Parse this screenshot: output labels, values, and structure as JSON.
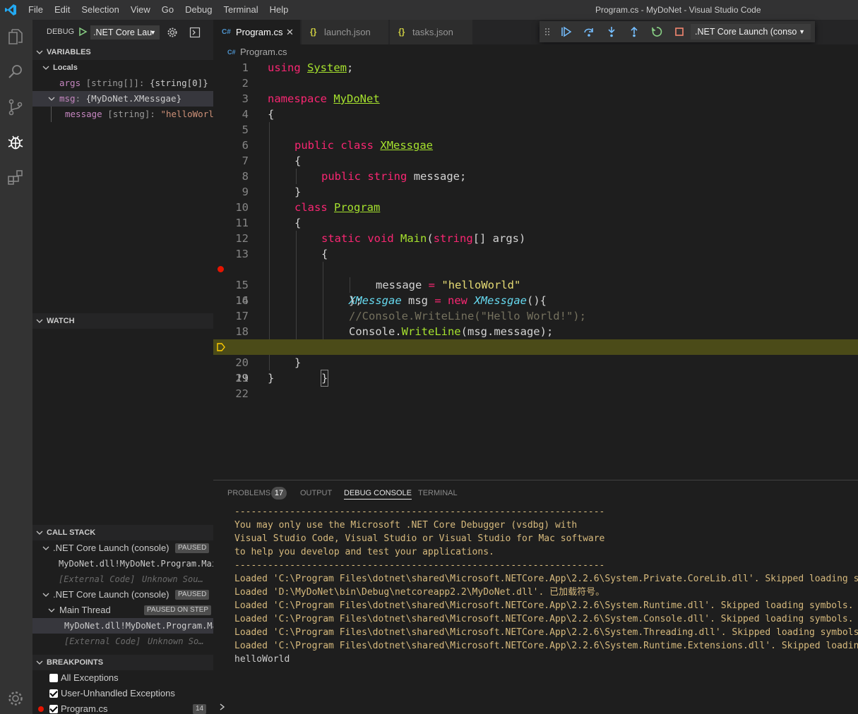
{
  "titlebar": {
    "menu": [
      "File",
      "Edit",
      "Selection",
      "View",
      "Go",
      "Debug",
      "Terminal",
      "Help"
    ],
    "title": "Program.cs - MyDoNet - Visual Studio Code"
  },
  "sidebar": {
    "debug_label": "DEBUG",
    "config": ".NET Core Lau",
    "variables": {
      "header": "VARIABLES",
      "locals": "Locals",
      "items": [
        {
          "name": "args",
          "type": " [string[]]: ",
          "value": "{string[0]}"
        },
        {
          "name": "msg",
          "type": ": ",
          "value": "{MyDoNet.XMessgae}"
        },
        {
          "name": "message",
          "type": " [string]: ",
          "value": "\"helloWorl…"
        }
      ]
    },
    "watch": {
      "header": "WATCH"
    },
    "callstack": {
      "header": "CALL STACK",
      "sessions": [
        {
          "name": ".NET Core Launch (console)",
          "badge": "PAUSED"
        },
        {
          "name": ".NET Core Launch (console)",
          "badge": "PAUSED"
        }
      ],
      "frame1": "MyDoNet.dll!MyDoNet.Program.Mai",
      "external1": "[External Code]",
      "unknown1": "Unknown Sou…",
      "thread": "Main Thread",
      "thread_badge": "PAUSED ON STEP",
      "frame2": "MyDoNet.dll!MyDoNet.Program.Ma",
      "external2": "[External Code]",
      "unknown2": "Unknown So…"
    },
    "breakpoints": {
      "header": "BREAKPOINTS",
      "items": [
        {
          "label": "All Exceptions",
          "checked": false
        },
        {
          "label": "User-Unhandled Exceptions",
          "checked": true
        },
        {
          "label": "Program.cs",
          "checked": true,
          "line": "14"
        }
      ]
    }
  },
  "tabs": [
    {
      "label": "Program.cs",
      "icon": "C#",
      "active": true
    },
    {
      "label": "launch.json",
      "icon": "{}",
      "active": false
    },
    {
      "label": "tasks.json",
      "icon": "{}",
      "active": false
    }
  ],
  "debug_toolbar": {
    "launch": ".NET Core Launch (conso"
  },
  "breadcrumb": {
    "file": "Program.cs"
  },
  "editor": {
    "line_numbers": [
      "1",
      "2",
      "3",
      "4",
      "5",
      "6",
      "7",
      "8",
      "9",
      "10",
      "11",
      "12",
      "13",
      "14",
      "15",
      "16",
      "17",
      "18",
      "19",
      "20",
      "21",
      "22"
    ],
    "t": {
      "using": "using",
      "System": "System",
      "semi": ";",
      "namespace": "namespace",
      "MyDoNet": "MyDoNet",
      "lbrace": "{",
      "rbrace": "}",
      "public": "public",
      "class": "class",
      "XMessgae": "XMessgae",
      "string": "string",
      "message": "message",
      "Program": "Program",
      "static": "static",
      "void": "void",
      "Main": "Main",
      "stringarr": "string",
      "args": "[] args)",
      "msg": " msg ",
      "eq": "=",
      "new": "new",
      "ctor": "(){",
      "helloWorld": "\"helloWorld\"",
      "closeinit": "};",
      "comment": "//Console.WriteLine(\"Hello World!\");",
      "Console": "Console.",
      "WriteLine": "WriteLine",
      "wlargs": "(msg.message);"
    }
  },
  "panel": {
    "tabs": [
      "PROBLEMS",
      "OUTPUT",
      "DEBUG CONSOLE",
      "TERMINAL"
    ],
    "problems_count": "17",
    "lines": [
      {
        "text": "-------------------------------------------------------------------",
        "kind": "warn"
      },
      {
        "text": "You may only use the Microsoft .NET Core Debugger (vsdbg) with",
        "kind": "warn"
      },
      {
        "text": "Visual Studio Code, Visual Studio or Visual Studio for Mac software",
        "kind": "warn"
      },
      {
        "text": "to help you develop and test your applications.",
        "kind": "warn"
      },
      {
        "text": "-------------------------------------------------------------------",
        "kind": "warn"
      },
      {
        "text": "Loaded 'C:\\Program Files\\dotnet\\shared\\Microsoft.NETCore.App\\2.2.6\\System.Private.CoreLib.dll'. Skipped loading sym",
        "kind": "warn"
      },
      {
        "text": "Loaded 'D:\\MyDoNet\\bin\\Debug\\netcoreapp2.2\\MyDoNet.dll'. 已加载符号。",
        "kind": "warn"
      },
      {
        "text": "Loaded 'C:\\Program Files\\dotnet\\shared\\Microsoft.NETCore.App\\2.2.6\\System.Runtime.dll'. Skipped loading symbols. Mo",
        "kind": "warn"
      },
      {
        "text": "Loaded 'C:\\Program Files\\dotnet\\shared\\Microsoft.NETCore.App\\2.2.6\\System.Console.dll'. Skipped loading symbols. Mo",
        "kind": "warn"
      },
      {
        "text": "Loaded 'C:\\Program Files\\dotnet\\shared\\Microsoft.NETCore.App\\2.2.6\\System.Threading.dll'. Skipped loading symbols.",
        "kind": "warn"
      },
      {
        "text": "Loaded 'C:\\Program Files\\dotnet\\shared\\Microsoft.NETCore.App\\2.2.6\\System.Runtime.Extensions.dll'. Skipped loading",
        "kind": "warn"
      },
      {
        "text": "helloWorld",
        "kind": "out"
      }
    ]
  },
  "colors": {
    "accent": "#007acc",
    "current_line": "#4b4b18",
    "breakpoint": "#e51400",
    "keyword": "#f92672",
    "type": "#a6e22e"
  }
}
